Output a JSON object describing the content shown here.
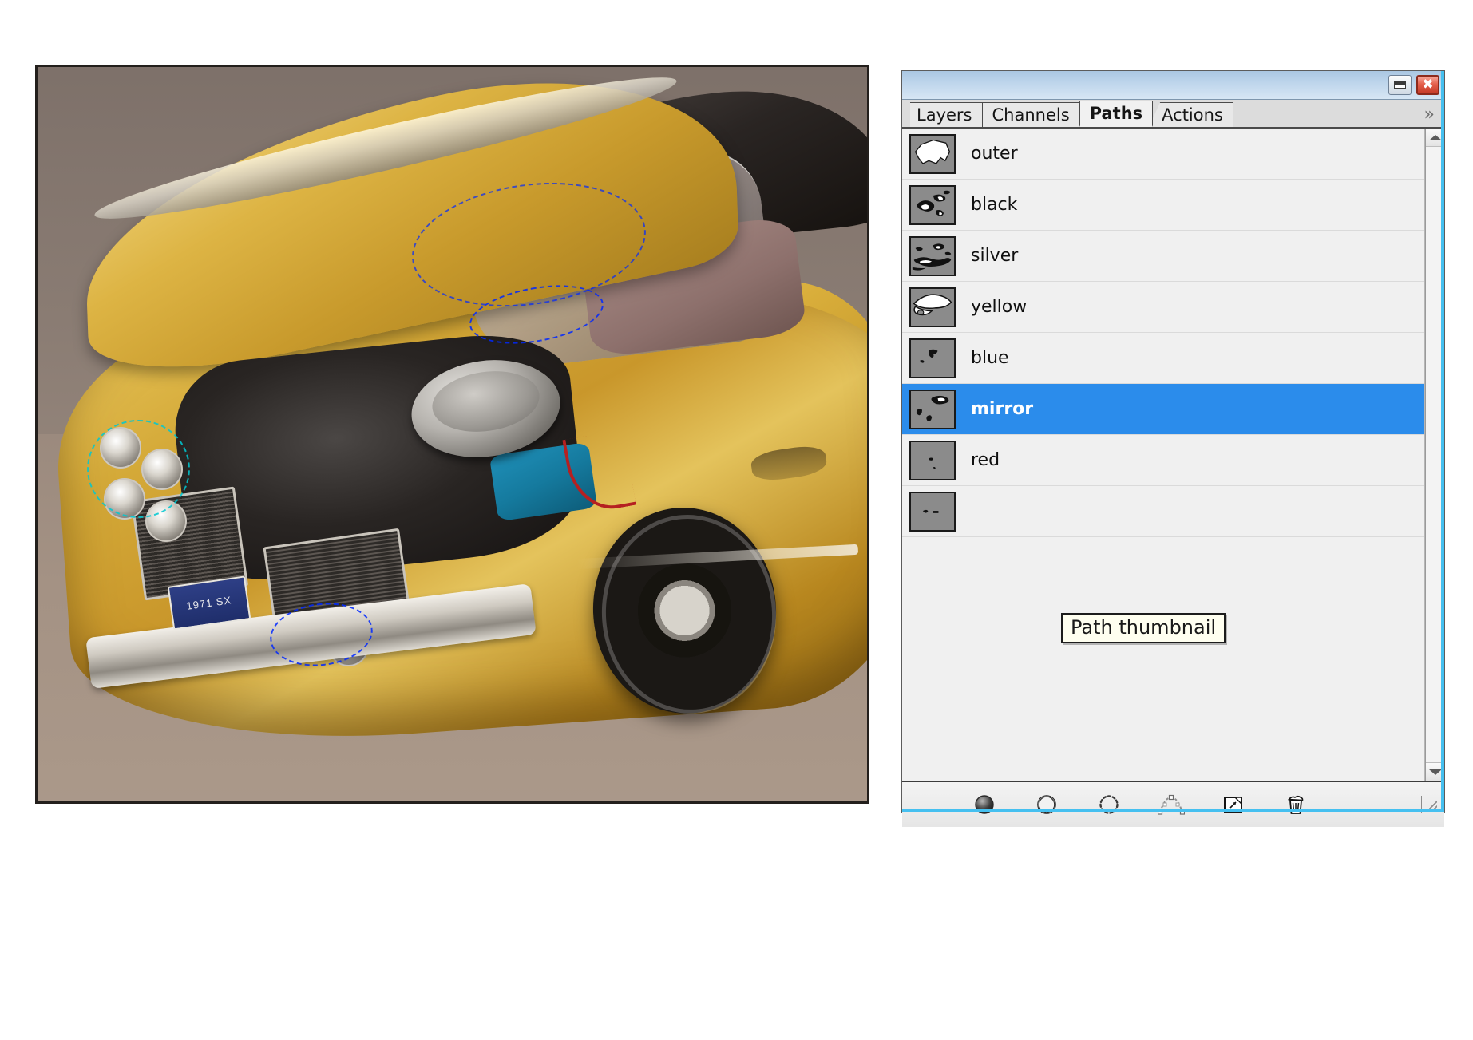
{
  "window": {
    "title_bar_buttons": [
      {
        "name": "collapse",
        "glyph": ""
      },
      {
        "name": "close",
        "glyph": "✖"
      }
    ]
  },
  "tabs": [
    {
      "label": "Layers",
      "active": false
    },
    {
      "label": "Channels",
      "active": false
    },
    {
      "label": "Paths",
      "active": true
    },
    {
      "label": "Actions",
      "active": false
    }
  ],
  "tab_overflow": "»",
  "paths": [
    {
      "label": "outer",
      "selected": false
    },
    {
      "label": "black",
      "selected": false
    },
    {
      "label": "silver",
      "selected": false
    },
    {
      "label": "yellow",
      "selected": false
    },
    {
      "label": "blue",
      "selected": false
    },
    {
      "label": "mirror",
      "selected": true
    },
    {
      "label": "red",
      "selected": false
    },
    {
      "label": "",
      "selected": false
    }
  ],
  "tooltip": {
    "text": "Path thumbnail"
  },
  "footer_buttons": [
    {
      "name": "fill-path-with-foreground-color"
    },
    {
      "name": "stroke-path-with-brush"
    },
    {
      "name": "load-path-as-selection"
    },
    {
      "name": "make-work-path-from-selection"
    },
    {
      "name": "create-new-path"
    },
    {
      "name": "delete-current-path"
    }
  ],
  "image": {
    "license_plate": "1971 SX",
    "colors": {
      "body_gold": "#d4a938",
      "roof_black": "#1d1a18",
      "selection_blue": "#2b8ceb",
      "accent_cyan": "#45c0f0",
      "tooltip_bg": "#fffff0",
      "panel_bg": "#f0f0f0",
      "titlebar_blue": "#bfd6ec"
    }
  }
}
